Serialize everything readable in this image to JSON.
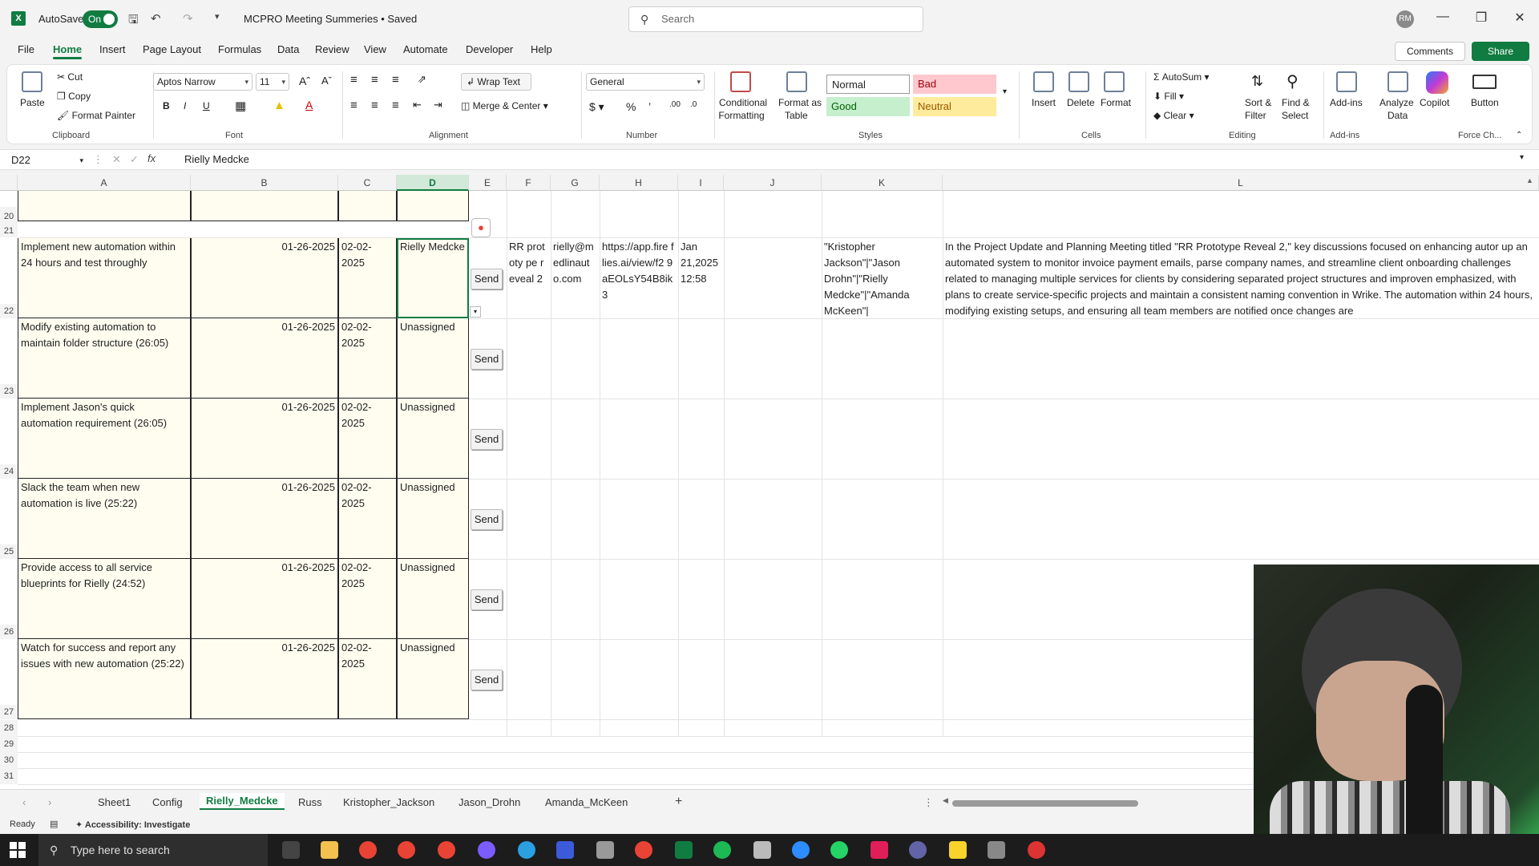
{
  "titlebar": {
    "autosave_label": "AutoSave",
    "autosave_state": "On",
    "doc_title": "MCPRO Meeting Summeries • Saved",
    "search_placeholder": "Search",
    "avatar_initials": "RM"
  },
  "menu": {
    "tabs": [
      "File",
      "Home",
      "Insert",
      "Page Layout",
      "Formulas",
      "Data",
      "Review",
      "View",
      "Automate",
      "Developer",
      "Help"
    ],
    "comments_label": "Comments",
    "share_label": "Share"
  },
  "ribbon": {
    "clipboard": {
      "paste": "Paste",
      "cut": "Cut",
      "copy": "Copy",
      "format_painter": "Format Painter",
      "label": "Clipboard"
    },
    "font": {
      "family": "Aptos Narrow",
      "size": "11",
      "label": "Font"
    },
    "alignment": {
      "wrap_text": "Wrap Text",
      "merge_center": "Merge & Center",
      "label": "Alignment"
    },
    "number": {
      "format": "General",
      "label": "Number"
    },
    "styles": {
      "conditional": "Conditional",
      "conditional2": "Formatting",
      "format_as": "Format as",
      "format_as2": "Table",
      "normal": "Normal",
      "bad": "Bad",
      "good": "Good",
      "neutral": "Neutral",
      "label": "Styles"
    },
    "cells": {
      "insert": "Insert",
      "delete": "Delete",
      "format": "Format",
      "label": "Cells"
    },
    "editing": {
      "autosum": "AutoSum",
      "fill": "Fill",
      "clear": "Clear",
      "sort": "Sort &",
      "sort2": "Filter",
      "find": "Find &",
      "find2": "Select",
      "label": "Editing"
    },
    "addins": {
      "addins": "Add-ins",
      "label": "Add-ins"
    },
    "analyze": {
      "line1": "Analyze",
      "line2": "Data"
    },
    "copilot": "Copilot",
    "button": "Button",
    "force": "Force Ch..."
  },
  "formula_bar": {
    "name_box": "D22",
    "fx": "fx",
    "content": "Rielly Medcke"
  },
  "columns": [
    "A",
    "B",
    "C",
    "D",
    "E",
    "F",
    "G",
    "H",
    "I",
    "J",
    "K",
    "L"
  ],
  "rows_top": [
    "20",
    "21"
  ],
  "tasks": [
    {
      "row": "22",
      "task": "Implement new automation within 24 hours and test throughly",
      "start": "01-26-2025",
      "due": "02-02-2025",
      "owner": "Rielly Medcke",
      "send": "Send"
    },
    {
      "row": "23",
      "task": "Modify existing automation to maintain folder structure (26:05)",
      "start": "01-26-2025",
      "due": "02-02-2025",
      "owner": "Unassigned",
      "send": "Send"
    },
    {
      "row": "24",
      "task": "Implement Jason's quick automation requirement (26:05)",
      "start": "01-26-2025",
      "due": "02-02-2025",
      "owner": "Unassigned",
      "send": "Send"
    },
    {
      "row": "25",
      "task": "Slack the team when new automation is live (25:22)",
      "start": "01-26-2025",
      "due": "02-02-2025",
      "owner": "Unassigned",
      "send": "Send"
    },
    {
      "row": "26",
      "task": "Provide access to all service blueprints for Rielly (24:52)",
      "start": "01-26-2025",
      "due": "02-02-2025",
      "owner": "Unassigned",
      "send": "Send"
    },
    {
      "row": "27",
      "task": "Watch for success and report any issues with new automation (25:22)",
      "start": "01-26-2025",
      "due": "02-02-2025",
      "owner": "Unassigned",
      "send": "Send"
    }
  ],
  "row22_extra": {
    "f": "RR prototy pe reveal 2",
    "g": "rielly@m edlinaut o.com",
    "h": "https://app.fire flies.ai/view/f2 9aEOLsY54B8ik 3",
    "i": "Jan 21,2025 12:58",
    "k": "\"Kristopher Jackson\"|\"Jason Drohn\"|\"Rielly Medcke\"|\"Amanda McKeen\"|",
    "l": "In the Project Update and Planning Meeting titled \"RR Prototype Reveal 2,\" key discussions focused on enhancing autor up an automated system to monitor invoice payment emails, parse company names, and streamline client onboarding challenges related to managing multiple services for clients by considering separated project structures and improven emphasized, with plans to create service-specific projects and maintain a consistent naming convention in Wrike. The automation within 24 hours, modifying existing setups, and ensuring all team members are notified once changes are"
  },
  "rows_bottom": [
    "28",
    "29",
    "30",
    "31"
  ],
  "sheets": [
    "Sheet1",
    "Config",
    "Rielly_Medcke",
    "Russ",
    "Kristopher_Jackson",
    "Jason_Drohn",
    "Amanda_McKeen"
  ],
  "active_sheet": "Rielly_Medcke",
  "status": {
    "ready": "Ready",
    "accessibility": "Accessibility: Investigate"
  },
  "taskbar": {
    "search_placeholder": "Type here to search"
  },
  "colors": {
    "excel_green": "#107c41",
    "task_fill": "#fffdf0",
    "bad_fill": "#ffc7ce",
    "good_fill": "#c6efce",
    "neutral_fill": "#ffeb9c"
  }
}
